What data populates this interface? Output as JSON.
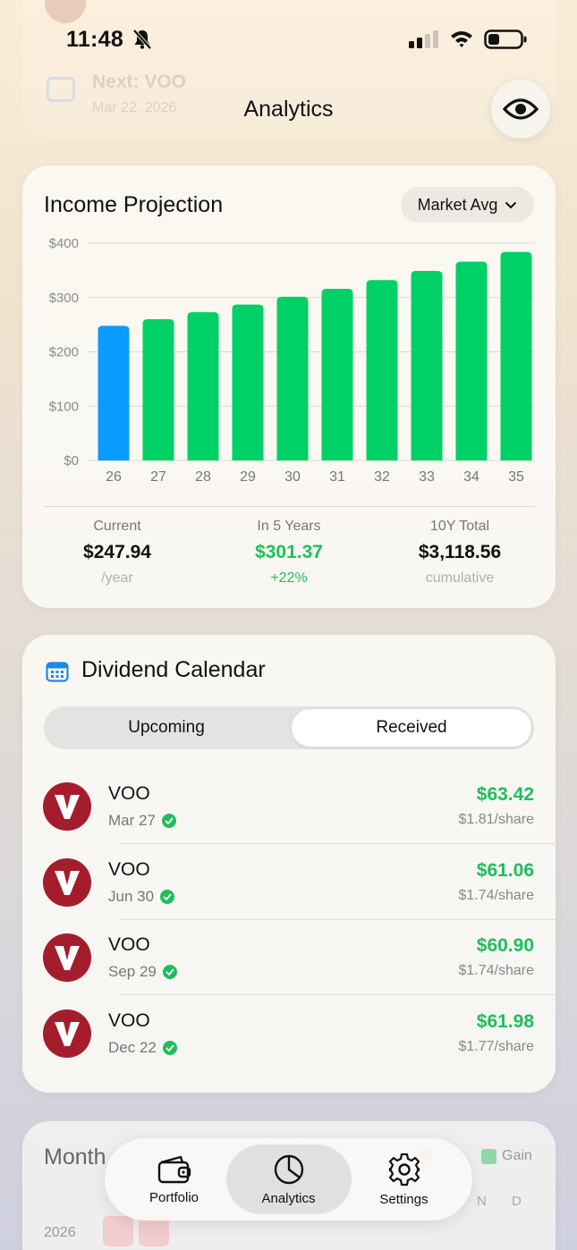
{
  "background_content": {
    "next_label": "Next: VOO",
    "next_date": "Mar 22, 2026"
  },
  "status_bar": {
    "time": "11:48"
  },
  "header": {
    "title": "Analytics"
  },
  "income_projection": {
    "title": "Income Projection",
    "mode_button": "Market Avg",
    "stats": [
      {
        "label": "Current",
        "value": "$247.94",
        "sub": "/year"
      },
      {
        "label": "In 5 Years",
        "value": "$301.37",
        "sub": "+22%"
      },
      {
        "label": "10Y Total",
        "value": "$3,118.56",
        "sub": "cumulative"
      }
    ]
  },
  "chart_data": {
    "type": "bar",
    "categories": [
      "26",
      "27",
      "28",
      "29",
      "30",
      "31",
      "32",
      "33",
      "34",
      "35"
    ],
    "values": [
      247.94,
      260,
      273,
      287,
      301.37,
      316,
      332,
      349,
      366,
      384
    ],
    "highlight_index": 0,
    "colors": {
      "current": "#0a9bff",
      "projected": "#00d166"
    },
    "y_ticks": [
      "$0",
      "$100",
      "$200",
      "$300",
      "$400"
    ],
    "ylim": [
      0,
      400
    ],
    "grid": true
  },
  "dividend_calendar": {
    "title": "Dividend Calendar",
    "tabs": [
      "Upcoming",
      "Received"
    ],
    "active_tab": "Received",
    "rows": [
      {
        "ticker": "VOO",
        "date": "Mar 27",
        "amount": "$63.42",
        "per_share": "$1.81/share"
      },
      {
        "ticker": "VOO",
        "date": "Jun 30",
        "amount": "$61.06",
        "per_share": "$1.74/share"
      },
      {
        "ticker": "VOO",
        "date": "Sep 29",
        "amount": "$60.90",
        "per_share": "$1.74/share"
      },
      {
        "ticker": "VOO",
        "date": "Dec 22",
        "amount": "$61.98",
        "per_share": "$1.77/share"
      }
    ]
  },
  "monthly": {
    "title": "Month",
    "legend_gain": "Gain",
    "col_n": "N",
    "col_d": "D",
    "year": "2026"
  },
  "tabbar": {
    "items": [
      "Portfolio",
      "Analytics",
      "Settings"
    ],
    "active": "Analytics"
  }
}
